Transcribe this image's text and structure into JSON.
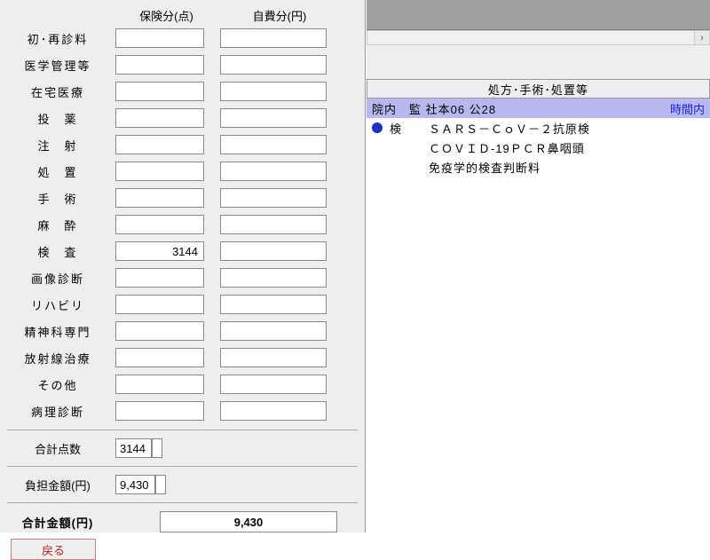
{
  "headers": {
    "col1": "保険分(点)",
    "col2": "自費分(円)"
  },
  "rows": [
    {
      "label": "初･再診料",
      "v1": "",
      "v2": ""
    },
    {
      "label": "医学管理等",
      "v1": "",
      "v2": ""
    },
    {
      "label": "在宅医療",
      "v1": "",
      "v2": ""
    },
    {
      "label": "投　薬",
      "v1": "",
      "v2": ""
    },
    {
      "label": "注　射",
      "v1": "",
      "v2": ""
    },
    {
      "label": "処　置",
      "v1": "",
      "v2": ""
    },
    {
      "label": "手　術",
      "v1": "",
      "v2": ""
    },
    {
      "label": "麻　酔",
      "v1": "",
      "v2": ""
    },
    {
      "label": "検　査",
      "v1": "3144",
      "v2": ""
    },
    {
      "label": "画像診断",
      "v1": "",
      "v2": ""
    },
    {
      "label": "リハビリ",
      "v1": "",
      "v2": ""
    },
    {
      "label": "精神科専門",
      "v1": "",
      "v2": ""
    },
    {
      "label": "放射線治療",
      "v1": "",
      "v2": ""
    },
    {
      "label": "その他",
      "v1": "",
      "v2": ""
    },
    {
      "label": "病理診断",
      "v1": "",
      "v2": ""
    }
  ],
  "totals": {
    "points_label": "合計点数",
    "points_v1": "3144",
    "points_v2": "",
    "burden_label": "負担金額(円)",
    "burden_v1": "9,430",
    "burden_v2": "",
    "grand_label": "合計金額(円)",
    "grand_value": "9,430"
  },
  "buttons": {
    "back": "戻る"
  },
  "right": {
    "section_header": "処方･手術･処置等",
    "highlight_left": "院内　監 社本06 公28",
    "highlight_right": "時間内",
    "detail_category": "検",
    "detail_lines": [
      "ＳＡＲＳ－ＣｏＶ－２抗原検",
      "ＣＯＶＩＤ-19ＰＣＲ鼻咽頭",
      "免疫学的検査判断料"
    ],
    "scroll_arrow": "›"
  }
}
